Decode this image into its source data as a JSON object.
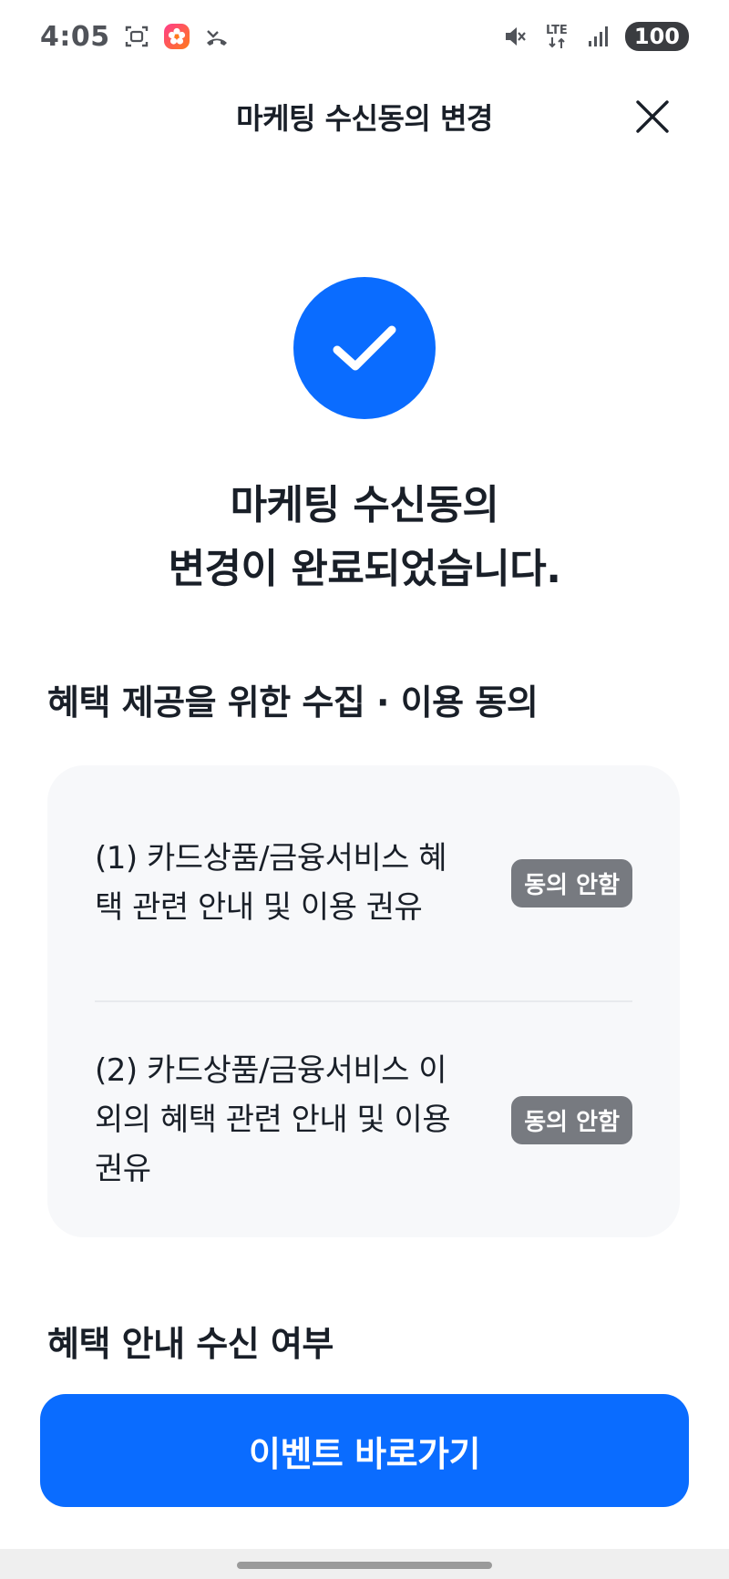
{
  "status_bar": {
    "time": "4:05",
    "battery": "100",
    "network": "LTE",
    "icons": [
      "screenshot-icon",
      "flower-app-icon",
      "missed-call-icon",
      "mute-icon",
      "signal-icon"
    ]
  },
  "header": {
    "title": "마케팅 수신동의 변경",
    "close_icon": "close-icon"
  },
  "result": {
    "icon": "check-icon",
    "headline_line1": "마케팅 수신동의",
    "headline_line2": "변경이 완료되었습니다."
  },
  "consent_section": {
    "title": "혜택 제공을 위한 수집 · 이용 동의",
    "items": [
      {
        "text": "(1) 카드상품/금융서비스 혜택 관련 안내 및 이용 권유",
        "status": "동의 안함"
      },
      {
        "text": "(2) 카드상품/금융서비스 이외의 혜택 관련 안내 및 이용 권유",
        "status": "동의 안함"
      }
    ]
  },
  "notice_section": {
    "title": "혜택 안내 수신 여부"
  },
  "cta": {
    "label": "이벤트 바로가기"
  },
  "colors": {
    "accent": "#0a6cff",
    "badge": "#777a80",
    "card_bg": "#f7f8fa",
    "text": "#191f28"
  }
}
